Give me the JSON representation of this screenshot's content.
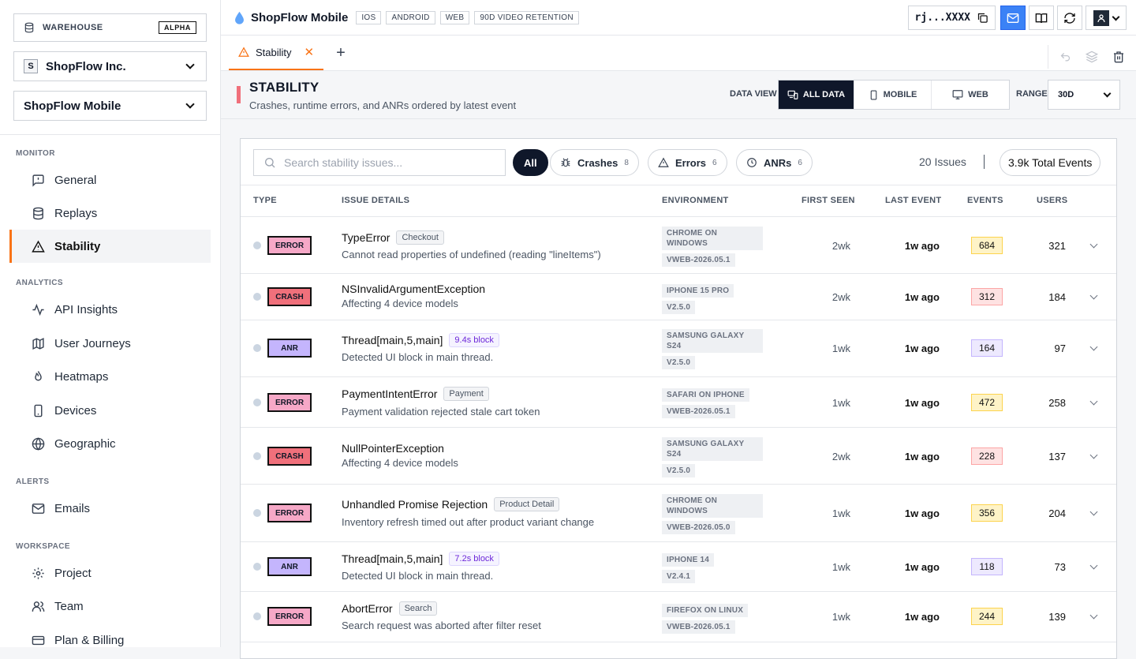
{
  "sidebar": {
    "warehouse": {
      "label": "WAREHOUSE",
      "badge": "ALPHA"
    },
    "org": {
      "initial": "S",
      "name": "ShopFlow Inc."
    },
    "project": {
      "name": "ShopFlow Mobile"
    },
    "sections": {
      "monitor": "MONITOR",
      "analytics": "ANALYTICS",
      "alerts": "ALERTS",
      "workspace": "WORKSPACE"
    },
    "items": {
      "general": "General",
      "replays": "Replays",
      "stability": "Stability",
      "api_insights": "API Insights",
      "user_journeys": "User Journeys",
      "heatmaps": "Heatmaps",
      "devices": "Devices",
      "geographic": "Geographic",
      "emails": "Emails",
      "project": "Project",
      "team": "Team",
      "billing": "Plan & Billing"
    },
    "active_accent": "#f97316"
  },
  "topbar": {
    "app_name": "ShopFlow Mobile",
    "platforms": [
      "IOS",
      "ANDROID",
      "WEB",
      "90D VIDEO RETENTION"
    ],
    "api_key": "rj...XXXX"
  },
  "tabs": {
    "active": "Stability",
    "add": "+"
  },
  "page": {
    "title": "STABILITY",
    "subtitle": "Crashes, runtime errors, and ANRs ordered by latest event",
    "data_view_label": "DATA VIEW",
    "data_views": [
      "ALL DATA",
      "MOBILE",
      "WEB"
    ],
    "range_label": "RANGE",
    "range_value": "30D"
  },
  "filters": {
    "search_placeholder": "Search stability issues...",
    "all": "All",
    "crashes": {
      "label": "Crashes",
      "count": "8"
    },
    "errors": {
      "label": "Errors",
      "count": "6"
    },
    "anrs": {
      "label": "ANRs",
      "count": "6"
    },
    "issues_count": "20 Issues",
    "total_events": "3.9k Total Events"
  },
  "table": {
    "headers": {
      "type": "TYPE",
      "details": "ISSUE DETAILS",
      "env": "ENVIRONMENT",
      "first_seen": "FIRST SEEN",
      "last_event": "LAST EVENT",
      "events": "EVENTS",
      "users": "USERS"
    },
    "rows": [
      {
        "type": "ERROR",
        "title": "TypeError",
        "tag": "Checkout",
        "desc": "Cannot read properties of undefined (reading \"lineItems\")",
        "env": [
          "CHROME ON WINDOWS",
          "VWEB-2026.05.1"
        ],
        "first_seen": "2wk",
        "last_event": "1w ago",
        "events": "684",
        "users": "321"
      },
      {
        "type": "CRASH",
        "title": "NSInvalidArgumentException",
        "tag": "",
        "desc": "Affecting 4 device models",
        "env": [
          "IPHONE 15 PRO",
          "V2.5.0"
        ],
        "first_seen": "2wk",
        "last_event": "1w ago",
        "events": "312",
        "users": "184"
      },
      {
        "type": "ANR",
        "title": "Thread[main,5,main]",
        "tag": "9.4s block",
        "desc": "Detected UI block in main thread.",
        "env": [
          "SAMSUNG GALAXY S24",
          "V2.5.0"
        ],
        "first_seen": "1wk",
        "last_event": "1w ago",
        "events": "164",
        "users": "97"
      },
      {
        "type": "ERROR",
        "title": "PaymentIntentError",
        "tag": "Payment",
        "desc": "Payment validation rejected stale cart token",
        "env": [
          "SAFARI ON IPHONE",
          "VWEB-2026.05.1"
        ],
        "first_seen": "1wk",
        "last_event": "1w ago",
        "events": "472",
        "users": "258"
      },
      {
        "type": "CRASH",
        "title": "NullPointerException",
        "tag": "",
        "desc": "Affecting 4 device models",
        "env": [
          "SAMSUNG GALAXY S24",
          "V2.5.0"
        ],
        "first_seen": "2wk",
        "last_event": "1w ago",
        "events": "228",
        "users": "137"
      },
      {
        "type": "ERROR",
        "title": "Unhandled Promise Rejection",
        "tag": "Product Detail",
        "desc": "Inventory refresh timed out after product variant change",
        "env": [
          "CHROME ON WINDOWS",
          "VWEB-2026.05.0"
        ],
        "first_seen": "1wk",
        "last_event": "1w ago",
        "events": "356",
        "users": "204"
      },
      {
        "type": "ANR",
        "title": "Thread[main,5,main]",
        "tag": "7.2s block",
        "desc": "Detected UI block in main thread.",
        "env": [
          "IPHONE 14",
          "V2.4.1"
        ],
        "first_seen": "1wk",
        "last_event": "1w ago",
        "events": "118",
        "users": "73"
      },
      {
        "type": "ERROR",
        "title": "AbortError",
        "tag": "Search",
        "desc": "Search request was aborted after filter reset",
        "env": [
          "FIREFOX ON LINUX",
          "VWEB-2026.05.1"
        ],
        "first_seen": "1wk",
        "last_event": "1w ago",
        "events": "244",
        "users": "139"
      }
    ]
  },
  "colors": {
    "error": "#f6a8c7",
    "crash": "#f0707b",
    "anr": "#c4b5fd",
    "primary_blue": "#3b82f6"
  }
}
